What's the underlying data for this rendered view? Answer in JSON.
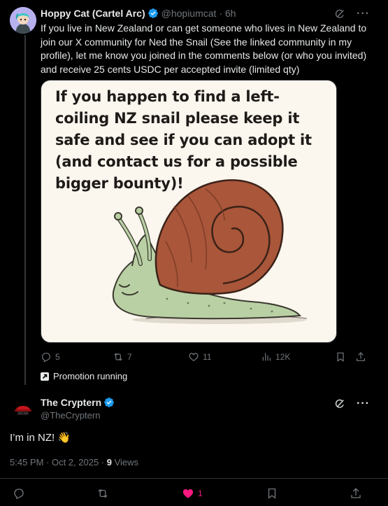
{
  "parent_tweet": {
    "author_name": "Hoppy Cat (Cartel Arc)",
    "author_handle": "@hopiumcat",
    "time": "· 6h",
    "text": "If you live in New Zealand or can get someone who lives in New Zealand to join our X community for Ned the Snail (See the linked community in my profile), let me know you joined in the comments below (or who you invited) and receive 25 cents USDC per accepted invite (limited qty)",
    "image_text": "If you happen to find a left-coiling NZ snail please keep it safe and see if you can adopt it (and contact us for a possible bigger bounty)!",
    "replies": "5",
    "reposts": "7",
    "likes": "11",
    "views": "12K",
    "promotion_label": "Promotion running"
  },
  "reply_tweet": {
    "author_name": "The Cryptern",
    "author_handle": "@TheCryptern",
    "text": "I’m in NZ!",
    "emoji": "👋",
    "timestamp": "5:45 PM · Oct 2, 2025 · ",
    "views_count": "9",
    "views_label": " Views",
    "likes": "1"
  },
  "icons": {
    "verified": "verified-badge-icon",
    "grok": "grok-icon",
    "more": "more-icon",
    "reply": "reply-icon",
    "repost": "repost-icon",
    "like": "heart-icon",
    "views": "views-icon",
    "bookmark": "bookmark-icon",
    "share": "share-icon",
    "promotion": "promotion-icon"
  },
  "colors": {
    "background": "#000000",
    "verified": "#1d9bf0",
    "like_active": "#f91880",
    "muted": "#71767b"
  }
}
